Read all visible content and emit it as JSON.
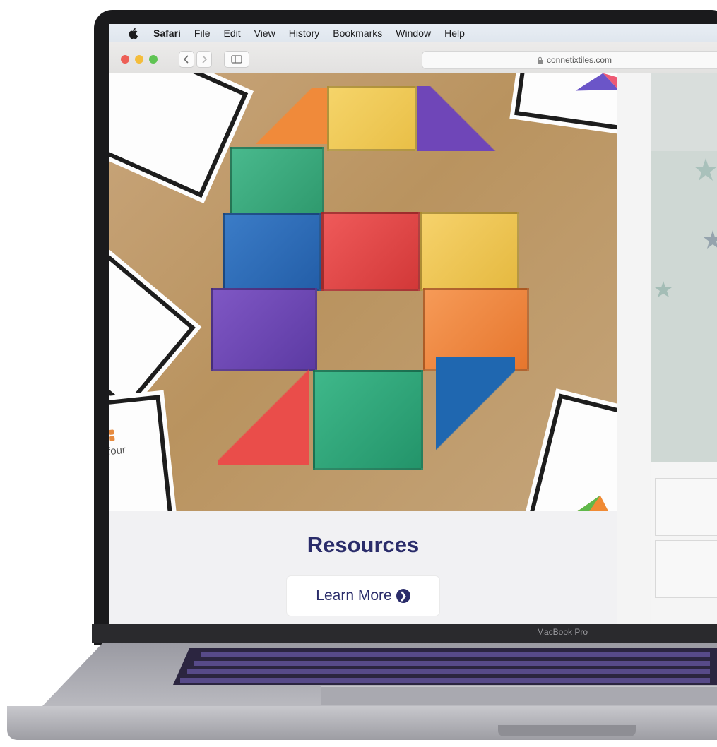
{
  "menubar": {
    "app_name": "Safari",
    "items": [
      "File",
      "Edit",
      "View",
      "History",
      "Bookmarks",
      "Window",
      "Help"
    ]
  },
  "toolbar": {
    "back_icon": "chevron-left-icon",
    "forward_icon": "chevron-right-icon",
    "sidebar_icon": "sidebar-icon",
    "url": "connetixtiles.com",
    "lock_icon": "lock-icon"
  },
  "photo": {
    "card_text": "four",
    "description_icon": "tiles-number-6"
  },
  "section": {
    "title": "Resources",
    "cta_label": "Learn More",
    "cta_icon": "circle-chevron-right-icon"
  },
  "laptop": {
    "model_label": "MacBook Pro"
  },
  "colors": {
    "title": "#2a2c6a",
    "traffic_red": "#ed5f56",
    "traffic_yellow": "#f4bd3c",
    "traffic_green": "#5fc453"
  }
}
